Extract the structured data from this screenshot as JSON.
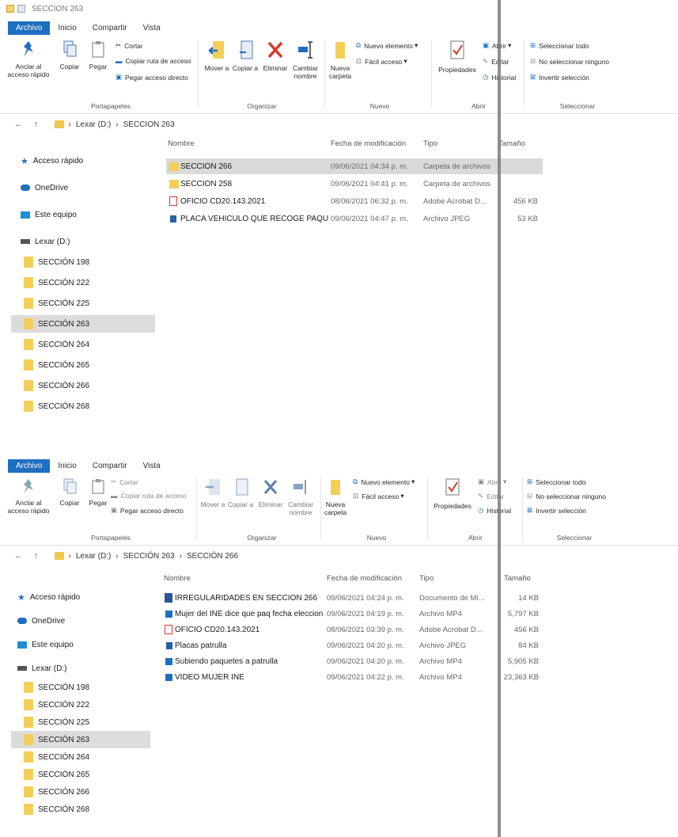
{
  "window1": {
    "title": "SECCION 263",
    "menu": [
      "Archivo",
      "Inicio",
      "Compartir",
      "Vista"
    ],
    "ribbon": {
      "pin": "Anclar al acceso rápido",
      "copy": "Copiar",
      "paste": "Pegar",
      "cut": "Cortar",
      "copy_path": "Copiar ruta de acceso",
      "paste_shortcut": "Pegar acceso directo",
      "clipboard_group": "Portapapeles",
      "move_to": "Mover a",
      "copy_to": "Copiar a",
      "delete": "Eliminar",
      "rename": "Cambiar nombre",
      "new_folder": "Nueva carpeta",
      "organize_group": "Organizar",
      "new_item": "Nuevo elemento",
      "easy_access": "Fácil acceso",
      "new_group": "Nuevo",
      "properties": "Propiedades",
      "open": "Abrir",
      "edit": "Editar",
      "history": "Historial",
      "open_group": "Abrir",
      "select_all": "Seleccionar todo",
      "select_none": "No seleccionar ninguno",
      "invert_selection": "Invertir selección",
      "select_group": "Seleccionar"
    },
    "breadcrumb": [
      "Lexar (D:)",
      "SECCION 263"
    ],
    "nav": {
      "quick_access": "Acceso rápido",
      "onedrive": "OneDrive",
      "this_pc": "Este equipo",
      "drive": "Lexar (D:)",
      "folders": [
        "SECCIÓN 198",
        "SECCIÓN 222",
        "SECCIÓN 225",
        "SECCIÓN 263",
        "SECCIÓN 264",
        "SECCIÓN 265",
        "SECCIÓN 266",
        "SECCIÓN 268"
      ]
    },
    "columns": {
      "name": "Nombre",
      "date": "Fecha de modificación",
      "type": "Tipo",
      "size": "Tamaño"
    },
    "files": [
      {
        "name": "SECCIÓN 266",
        "date": "09/06/2021 04:34 p. m.",
        "type": "Carpeta de archivos",
        "size": ""
      },
      {
        "name": "SECCIÓN 258",
        "date": "09/06/2021 04:41 p. m.",
        "type": "Carpeta de archivos",
        "size": ""
      },
      {
        "name": "OFICIO CD20.143.2021",
        "date": "08/06/2021 06:32 p. m.",
        "type": "Adobe Acrobat D...",
        "size": "456 KB"
      },
      {
        "name": "PLACA VEHICULO QUE RECOGE PAQUET...",
        "date": "09/06/2021 04:47 p. m.",
        "type": "Archivo JPEG",
        "size": "53 KB"
      }
    ]
  },
  "window2": {
    "menu": [
      "Archivo",
      "Inicio",
      "Compartir",
      "Vista"
    ],
    "ribbon": {
      "pin": "Anclar al acceso rápido",
      "copy": "Copiar",
      "paste": "Pegar",
      "cut": "Cortar",
      "copy_path": "Copiar ruta de acceso",
      "paste_shortcut": "Pegar acceso directo",
      "clipboard_group": "Portapapeles",
      "move_to": "Mover a",
      "copy_to": "Copiar a",
      "delete": "Eliminar",
      "rename": "Cambiar nombre",
      "new_folder": "Nueva carpeta",
      "organize_group": "Organizar",
      "new_item": "Nuevo elemento",
      "easy_access": "Fácil acceso",
      "new_group": "Nuevo",
      "properties": "Propiedades",
      "open": "Abrir",
      "edit": "Editar",
      "history": "Historial",
      "open_group": "Abrir",
      "select_all": "Seleccionar todo",
      "select_none": "No seleccionar ninguno",
      "invert_selection": "Invertir selección",
      "select_group": "Seleccionar"
    },
    "breadcrumb": [
      "Lexar (D:)",
      "SECCIÓN 263",
      "SECCIÓN 266"
    ],
    "nav": {
      "quick_access": "Acceso rápido",
      "onedrive": "OneDrive",
      "this_pc": "Este equipo",
      "drive": "Lexar (D:)",
      "folders": [
        "SECCIÓN 198",
        "SECCIÓN 222",
        "SECCIÓN 225",
        "SECCIÓN 263",
        "SECCIÓN 264",
        "SECCIÓN 265",
        "SECCIÓN 266",
        "SECCIÓN 268"
      ]
    },
    "columns": {
      "name": "Nombre",
      "date": "Fecha de modificación",
      "type": "Tipo",
      "size": "Tamaño"
    },
    "files": [
      {
        "name": "IRREGULARIDADES EN SECCIÓN 266",
        "date": "09/06/2021 04:24 p. m.",
        "type": "Documento de Mi...",
        "size": "14 KB"
      },
      {
        "name": "Mujer del INE dice que paq fecha eleccion...",
        "date": "09/06/2021 04:19 p. m.",
        "type": "Archivo MP4",
        "size": "5,797 KB"
      },
      {
        "name": "OFICIO CD20.143.2021",
        "date": "08/06/2021 03:39 p. m.",
        "type": "Adobe Acrobat D...",
        "size": "456 KB"
      },
      {
        "name": "Placas patrulla",
        "date": "09/06/2021 04:20 p. m.",
        "type": "Archivo JPEG",
        "size": "84 KB"
      },
      {
        "name": "Subiendo paquetes a patrulla",
        "date": "09/06/2021 04:20 p. m.",
        "type": "Archivo MP4",
        "size": "5,905 KB"
      },
      {
        "name": "VIDEO MUJER INE",
        "date": "09/06/2021 04:22 p. m.",
        "type": "Archivo MP4",
        "size": "23,363 KB"
      }
    ]
  }
}
